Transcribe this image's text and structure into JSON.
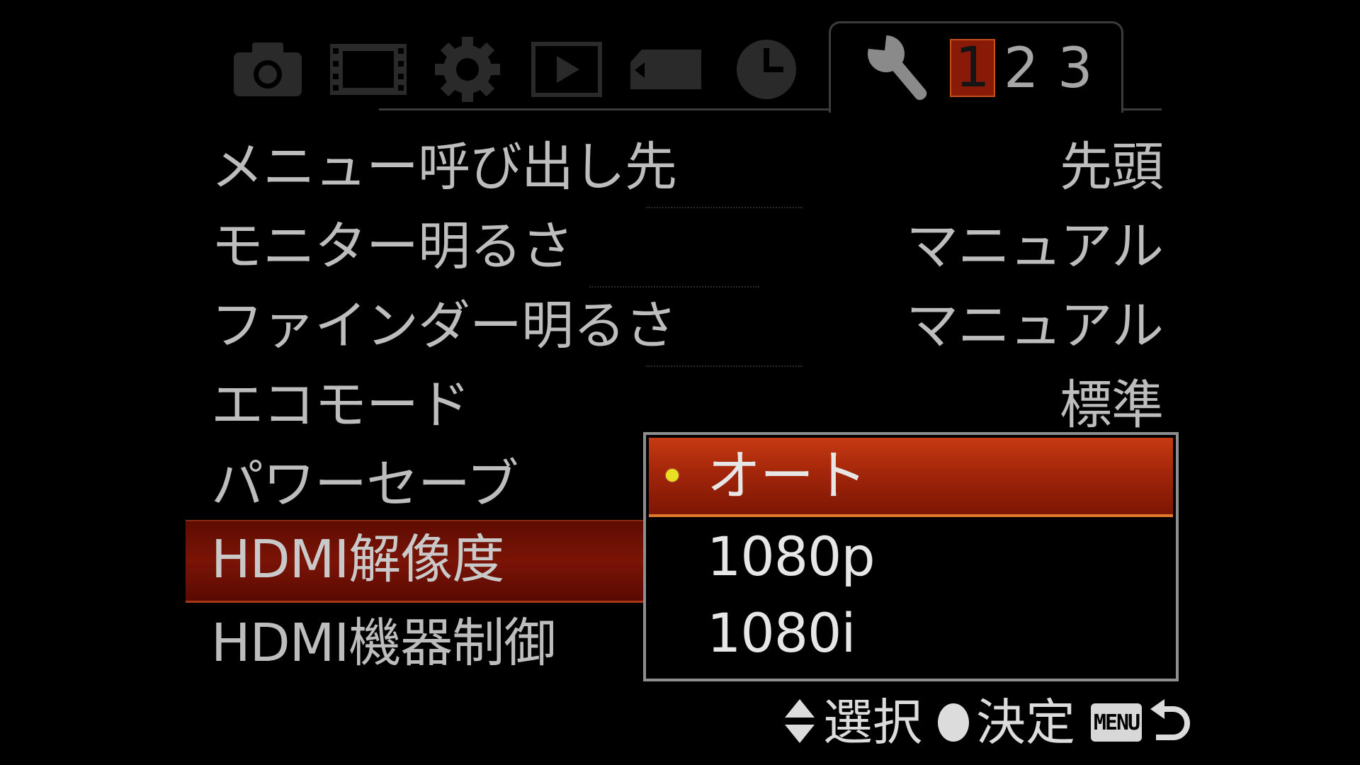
{
  "tabs": {
    "icons": [
      "camera-icon",
      "film-icon",
      "gear-icon",
      "play-icon",
      "memory-card-icon",
      "clock-icon",
      "wrench-icon"
    ],
    "pages": [
      "1",
      "2",
      "3"
    ],
    "active_page": "1"
  },
  "menu": {
    "items": [
      {
        "label": "メニュー呼び出し先",
        "value": "先頭"
      },
      {
        "label": "モニター明るさ",
        "value": "マニュアル"
      },
      {
        "label": "ファインダー明るさ",
        "value": "マニュアル"
      },
      {
        "label": "エコモード",
        "value": "標準"
      },
      {
        "label": "パワーセーブ",
        "value": ""
      },
      {
        "label": "HDMI解像度",
        "value": ""
      },
      {
        "label": "HDMI機器制御",
        "value": ""
      }
    ],
    "selected_index": 5
  },
  "dropdown": {
    "options": [
      "オート",
      "1080p",
      "1080i"
    ],
    "highlighted_index": 0
  },
  "help": {
    "select": "選択",
    "confirm": "決定",
    "menu_key": "MENU"
  },
  "colors": {
    "accent_red": "#a3260a",
    "highlight_border": "#e07a2a",
    "selected_dot": "#e8e020"
  }
}
